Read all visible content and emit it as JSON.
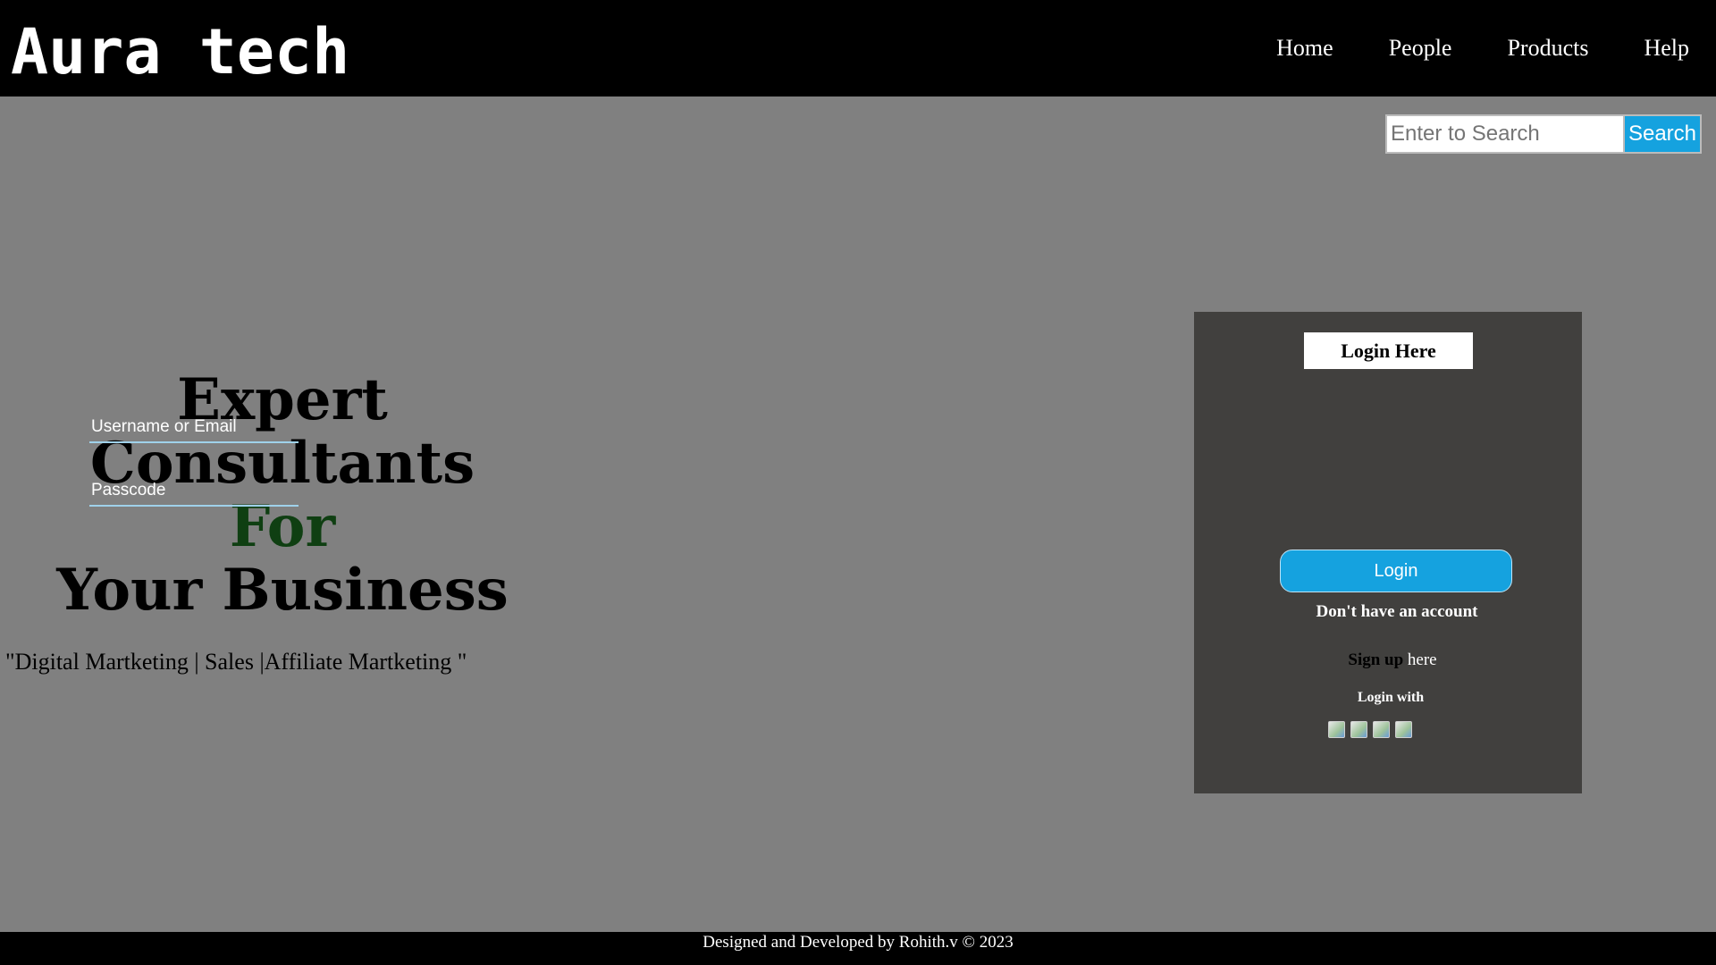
{
  "header": {
    "brand": "Aura tech",
    "nav": [
      {
        "label": "Home"
      },
      {
        "label": "People"
      },
      {
        "label": "Products"
      },
      {
        "label": "Help"
      }
    ]
  },
  "search": {
    "placeholder": "Enter to Search",
    "value": "",
    "button_label": "Search"
  },
  "hero": {
    "line1": "Expert Consultants",
    "line2": "For",
    "line3": "Your Business",
    "tagline": "\"Digital Martketing | Sales |Affiliate Martketing \""
  },
  "login": {
    "title": "Login Here",
    "username_placeholder": "Username or Email",
    "password_placeholder": "Passcode",
    "button_label": "Login",
    "no_account_text": "Don't have an account",
    "signup_link": "Sign up",
    "signup_suffix": " here",
    "login_with": "Login with",
    "social_icons": [
      "social-icon-1",
      "social-icon-2",
      "social-icon-3",
      "social-icon-4"
    ]
  },
  "footer": {
    "text": "Designed and Developed by Rohith.v © 2023"
  },
  "colors": {
    "page_background": "#808080",
    "header_background": "#000000",
    "accent": "#15a2df",
    "panel_background": "#41403e",
    "hero_for_color": "#0f3f12"
  }
}
